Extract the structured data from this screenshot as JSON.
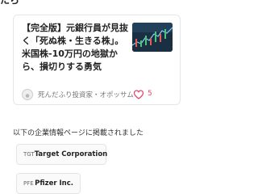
{
  "top_heading_clipped": "たら",
  "article": {
    "title": "【完全版】元銀行員が見抜く「死ぬ株・生きる株」。米国株-10万円の地獄から、損切りする勇気",
    "author": "死んだふり投資家・オポッサム",
    "likes": "5",
    "thumbnail_icon": "stock-chart-thumbnail-icon",
    "like_icon": "heart-icon"
  },
  "companies_section": {
    "title": "以下の企業情報ページに掲載されました",
    "companies": [
      {
        "ticker": "TGT",
        "name": "Target Corporation"
      },
      {
        "ticker": "PFE",
        "name": "Pfizer Inc."
      }
    ]
  },
  "colors": {
    "like": "#e2486b",
    "border": "#e6e6e6",
    "text": "#222222",
    "muted": "#777777"
  }
}
